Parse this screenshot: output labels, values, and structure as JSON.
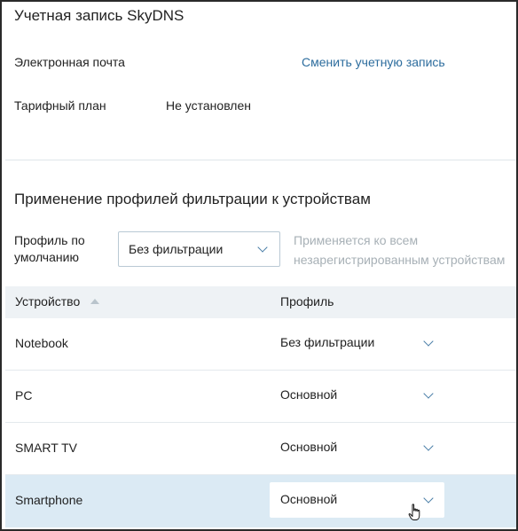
{
  "account": {
    "title": "Учетная запись SkyDNS",
    "email_label": "Электронная почта",
    "change_account_link": "Сменить учетную запись",
    "plan_label": "Тарифный план",
    "plan_value": "Не установлен"
  },
  "filtering": {
    "title": "Применение профилей фильтрации к устройствам",
    "default_profile_label": "Профиль по умолчанию",
    "default_profile_value": "Без фильтрации",
    "hint": "Применяется ко всем незарегистрированным устройствам"
  },
  "table": {
    "col_device": "Устройство",
    "col_profile": "Профиль",
    "rows": [
      {
        "device": "Notebook",
        "profile": "Без фильтрации"
      },
      {
        "device": "PC",
        "profile": "Основной"
      },
      {
        "device": "SMART TV",
        "profile": "Основной"
      },
      {
        "device": "Smartphone",
        "profile": "Основной"
      }
    ]
  },
  "colors": {
    "link": "#2d6d9e",
    "header_bg": "#eef2f5",
    "selected_row_bg": "#dbeaf4",
    "hint": "#a7b0b6"
  },
  "icons": {
    "dropdown": "chevron-down-icon",
    "sort": "sort-ascending-icon",
    "cursor": "hand-pointer-icon"
  }
}
